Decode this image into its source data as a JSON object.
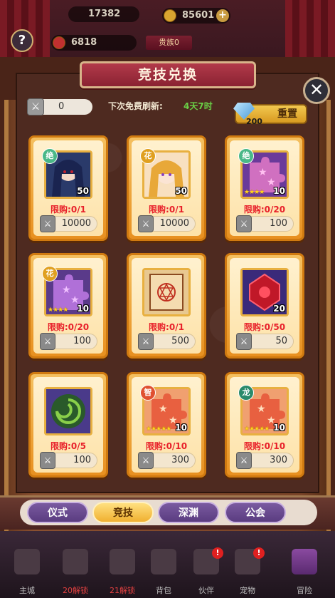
{
  "top_bar": {
    "stat_partial": "17382",
    "gold": "85601",
    "gold_plus": "+",
    "power": "6818",
    "noble_label": "贵族0",
    "help_label": "?"
  },
  "panel": {
    "title": "竞技兑换",
    "close_label": "✕",
    "token_count": "0",
    "refresh_label": "下次免费刷新:",
    "refresh_value": "4天7时",
    "reset_cost": "200",
    "reset_label": "重置"
  },
  "items": [
    {
      "badge": "绝",
      "badge_color": "#4ab888",
      "count": "50",
      "stars": "",
      "limit": "限购:0/1",
      "price": "10000",
      "art": "portrait-dark"
    },
    {
      "badge": "花",
      "badge_color": "#e0a020",
      "count": "50",
      "stars": "",
      "limit": "限购:0/1",
      "price": "10000",
      "art": "portrait-blonde"
    },
    {
      "badge": "绝",
      "badge_color": "#4ab888",
      "count": "10",
      "stars": "★★★★",
      "limit": "限购:0/20",
      "price": "100",
      "art": "puzzle-pink"
    },
    {
      "badge": "花",
      "badge_color": "#e0a020",
      "count": "10",
      "stars": "★★★★",
      "limit": "限购:0/20",
      "price": "100",
      "art": "puzzle-purple"
    },
    {
      "badge": "",
      "badge_color": "",
      "count": "",
      "stars": "",
      "limit": "限购:0/1",
      "price": "500",
      "art": "scroll"
    },
    {
      "badge": "",
      "badge_color": "",
      "count": "20",
      "stars": "",
      "limit": "限购:0/50",
      "price": "50",
      "art": "ruby"
    },
    {
      "badge": "",
      "badge_color": "",
      "count": "",
      "stars": "",
      "limit": "限购:0/5",
      "price": "100",
      "art": "orb"
    },
    {
      "badge": "智",
      "badge_color": "#e05030",
      "count": "10",
      "stars": "★★★★★",
      "limit": "限购:0/10",
      "price": "300",
      "art": "puzzle-orange"
    },
    {
      "badge": "龙",
      "badge_color": "#2a8a6a",
      "count": "10",
      "stars": "★★★★★",
      "limit": "限购:0/10",
      "price": "300",
      "art": "puzzle-orange"
    }
  ],
  "tabs": [
    {
      "label": "仪式",
      "active": false
    },
    {
      "label": "竞技",
      "active": true
    },
    {
      "label": "深渊",
      "active": false
    },
    {
      "label": "公会",
      "active": false
    }
  ],
  "bottom_nav": [
    {
      "label": "主城",
      "label_color": "normal",
      "icon": "castle-icon",
      "dot": ""
    },
    {
      "label": "20解锁",
      "label_color": "red",
      "icon": "lock-icon",
      "dot": ""
    },
    {
      "label": "21解锁",
      "label_color": "red",
      "icon": "lock-icon",
      "dot": ""
    },
    {
      "label": "背包",
      "label_color": "normal",
      "icon": "bag-icon",
      "dot": ""
    },
    {
      "label": "伙伴",
      "label_color": "normal",
      "icon": "partner-icon",
      "dot": "!"
    },
    {
      "label": "宠物",
      "label_color": "normal",
      "icon": "pet-icon",
      "dot": "!"
    },
    {
      "label": "冒险",
      "label_color": "normal",
      "icon": "swords-icon",
      "dot": ""
    }
  ]
}
